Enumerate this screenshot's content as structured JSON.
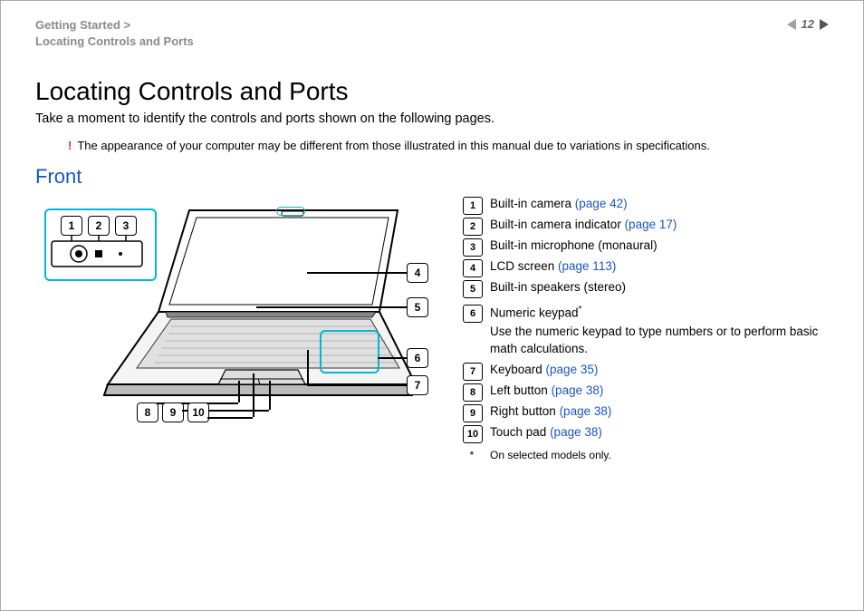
{
  "header": {
    "breadcrumb1": "Getting Started >",
    "breadcrumb2": "Locating Controls and Ports",
    "page_number": "12"
  },
  "title": "Locating Controls and Ports",
  "intro": "Take a moment to identify the controls and ports shown on the following pages.",
  "note": {
    "bang": "!",
    "text": "The appearance of your computer may be different from those illustrated in this manual due to variations in specifications."
  },
  "section_heading": "Front",
  "callouts": [
    "1",
    "2",
    "3",
    "4",
    "5",
    "6",
    "7",
    "8",
    "9",
    "10"
  ],
  "legend": [
    {
      "n": "1",
      "text": "Built-in camera ",
      "link": "(page 42)"
    },
    {
      "n": "2",
      "text": "Built-in camera indicator ",
      "link": "(page 17)"
    },
    {
      "n": "3",
      "text": "Built-in microphone (monaural)",
      "link": ""
    },
    {
      "n": "4",
      "text": "LCD screen ",
      "link": "(page 113)"
    },
    {
      "n": "5",
      "text": "Built-in speakers (stereo)",
      "link": ""
    },
    {
      "n": "6",
      "text": "Numeric keypad",
      "link": "",
      "sup": "*",
      "sub": "Use the numeric keypad to type numbers or to perform basic math calculations."
    },
    {
      "n": "7",
      "text": "Keyboard ",
      "link": "(page 35)"
    },
    {
      "n": "8",
      "text": "Left button ",
      "link": "(page 38)"
    },
    {
      "n": "9",
      "text": "Right button ",
      "link": "(page 38)"
    },
    {
      "n": "10",
      "text": "Touch pad ",
      "link": "(page 38)"
    }
  ],
  "footnote": {
    "star": "*",
    "text": "On selected models only."
  }
}
